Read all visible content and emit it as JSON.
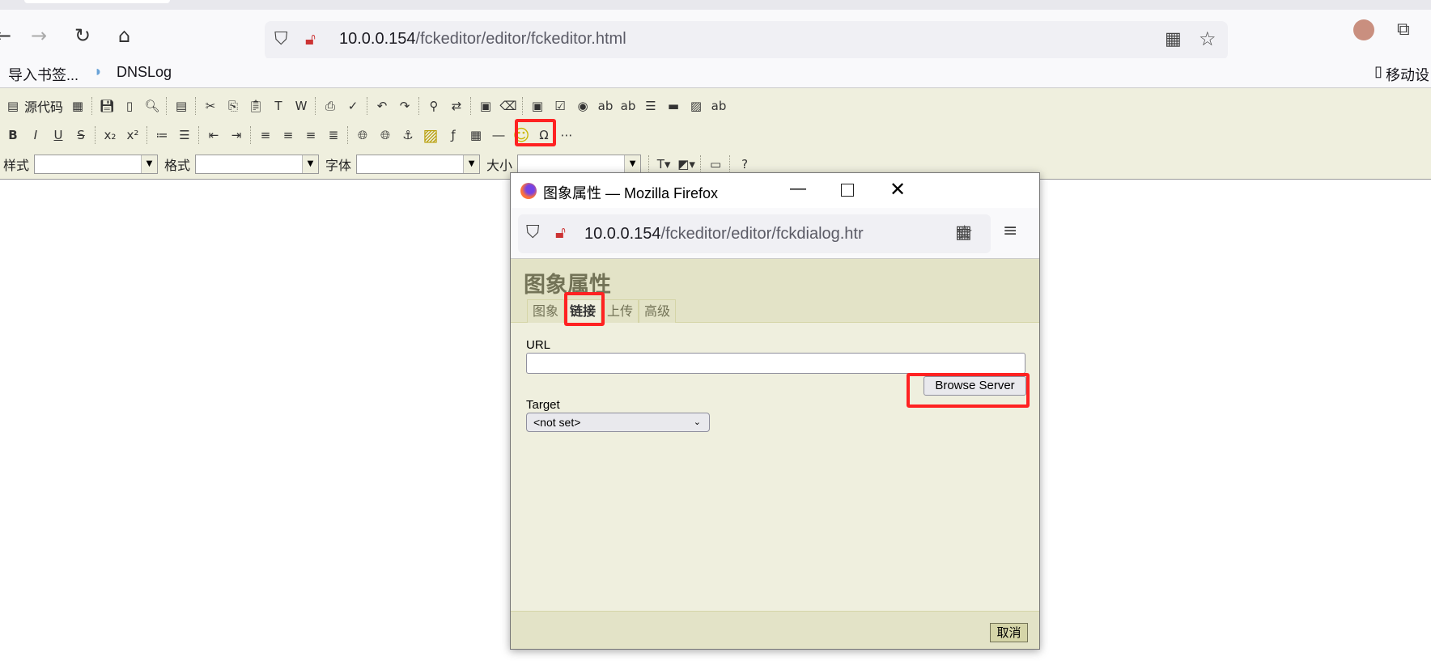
{
  "browser": {
    "url_host": "10.0.0.154",
    "url_path": "/fckeditor/editor/fckeditor.html",
    "bookmarks": [
      "导入书签...",
      "DNSLog"
    ],
    "mobile_bookmarks": "移动设"
  },
  "editor": {
    "source_label": "源代码",
    "row1": [
      "source",
      "document-properties",
      "|",
      "save",
      "new-page",
      "preview",
      "|",
      "templates",
      "|",
      "cut",
      "copy",
      "paste",
      "paste-text",
      "paste-word",
      "|",
      "print",
      "spellcheck",
      "|",
      "undo",
      "redo",
      "|",
      "find",
      "replace",
      "|",
      "select-all",
      "remove-format",
      "|",
      "form",
      "checkbox",
      "radio",
      "text-field",
      "textarea",
      "select-field",
      "button",
      "image-button",
      "hidden-field"
    ],
    "row2": [
      "bold",
      "italic",
      "underline",
      "strikethrough",
      "|",
      "subscript",
      "superscript",
      "|",
      "ordered-list",
      "unordered-list",
      "|",
      "outdent",
      "indent",
      "|",
      "justify-left",
      "justify-center",
      "justify-right",
      "justify-full",
      "|",
      "link",
      "unlink",
      "anchor",
      "image",
      "flash",
      "table",
      "horizontal-rule",
      "smiley",
      "special-char",
      "page-break"
    ],
    "combos": [
      {
        "label": "样式",
        "value": ""
      },
      {
        "label": "格式",
        "value": ""
      },
      {
        "label": "字体",
        "value": ""
      },
      {
        "label": "大小",
        "value": ""
      }
    ],
    "row3_tail": [
      "|",
      "text-color",
      "background-color",
      "|",
      "fit-window",
      "|",
      "about"
    ]
  },
  "dialog": {
    "window_title": "图象属性 — Mozilla Firefox",
    "url_host": "10.0.0.154",
    "url_path": "/fckeditor/editor/fckdialog.htr",
    "heading": "图象属性",
    "tabs": [
      {
        "label": "图象",
        "active": false
      },
      {
        "label": "链接",
        "active": true
      },
      {
        "label": "上传",
        "active": false
      },
      {
        "label": "高级",
        "active": false
      }
    ],
    "url_label": "URL",
    "url_value": "",
    "browse_server": "Browse Server",
    "target_label": "Target",
    "target_value": "<not set>",
    "cancel": "取消"
  },
  "colors": {
    "highlight": "#ff2222",
    "toolbar_bg": "#efefde",
    "dialog_head": "#e3e3c7"
  }
}
